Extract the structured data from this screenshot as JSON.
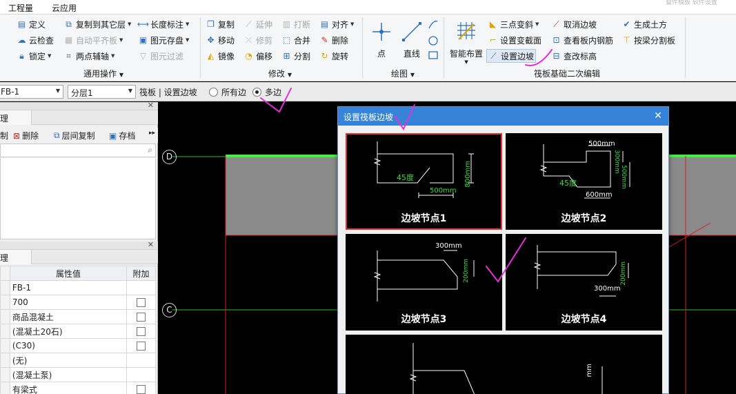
{
  "menubar": {
    "items": [
      "工程量",
      "云应用"
    ],
    "ghost": "套件模板    软件设置"
  },
  "ribbon": {
    "groups": {
      "general": {
        "label": "通用操作",
        "buttons": [
          "定义",
          "复制到其它层",
          "长度标注",
          "云检查",
          "自动平齐板",
          "图元存盘",
          "锁定",
          "两点辅轴",
          "图元过滤"
        ]
      },
      "modify": {
        "label": "修改",
        "buttons": [
          "复制",
          "延伸",
          "打断",
          "对齐",
          "移动",
          "修剪",
          "合并",
          "删除",
          "镜像",
          "偏移",
          "分割",
          "旋转"
        ]
      },
      "draw": {
        "label": "绘图",
        "buttons": [
          "点",
          "直线"
        ]
      },
      "raft": {
        "label": "筏板基础二次编辑",
        "buttons": [
          "智能布置",
          "三点变斜",
          "设置变截面",
          "设置边坡",
          "取消边坡",
          "查看板内钢筋",
          "查改标高",
          "生成土方",
          "按梁分割板"
        ]
      }
    }
  },
  "context": {
    "element_combo": "FB-1",
    "layer_combo": "分层1",
    "path": "筏板 | 设置边坡",
    "radio_all": "所有边",
    "radio_multi": "多边",
    "selected_radio": "多边"
  },
  "left_panel": {
    "upper_tab": "理",
    "tools": [
      "删除",
      "层间复制",
      "存档"
    ],
    "tool_prefix": "制",
    "lower_tab": "理",
    "table": {
      "headers": [
        "属性值",
        "附加"
      ],
      "rows": [
        {
          "value": "FB-1",
          "check": false
        },
        {
          "value": "700",
          "check": true
        },
        {
          "value": "商品混凝土",
          "check": true
        },
        {
          "value": "(混凝土20石)",
          "check": true
        },
        {
          "value": "(C30)",
          "check": true
        },
        {
          "value": "(无)",
          "check": false
        },
        {
          "value": "(混凝土泵)",
          "check": false
        },
        {
          "value": "有梁式",
          "check": true
        }
      ]
    }
  },
  "canvas": {
    "axis_labels": [
      "D",
      "C"
    ]
  },
  "dialog": {
    "title": "设置筏板边坡",
    "nodes": [
      {
        "caption": "边坡节点1",
        "dims": [
          "800mm",
          "45度",
          "500mm"
        ],
        "selected": true
      },
      {
        "caption": "边坡节点2",
        "dims": [
          "500mm",
          "300mm",
          "500mm",
          "45度",
          "600mm"
        ],
        "selected": false
      },
      {
        "caption": "边坡节点3",
        "dims": [
          "300mm",
          "200mm"
        ],
        "selected": false
      },
      {
        "caption": "边坡节点4",
        "dims": [
          "300mm",
          "200mm"
        ],
        "selected": false
      },
      {
        "dims": [
          "mm"
        ]
      }
    ]
  },
  "colors": {
    "ribbon_bg": "#f5f6f7",
    "dialog_title": "#3584d9",
    "selected_border": "#e03232",
    "dim_green": "#3ddc3d",
    "handwriting": "#e331d6"
  }
}
